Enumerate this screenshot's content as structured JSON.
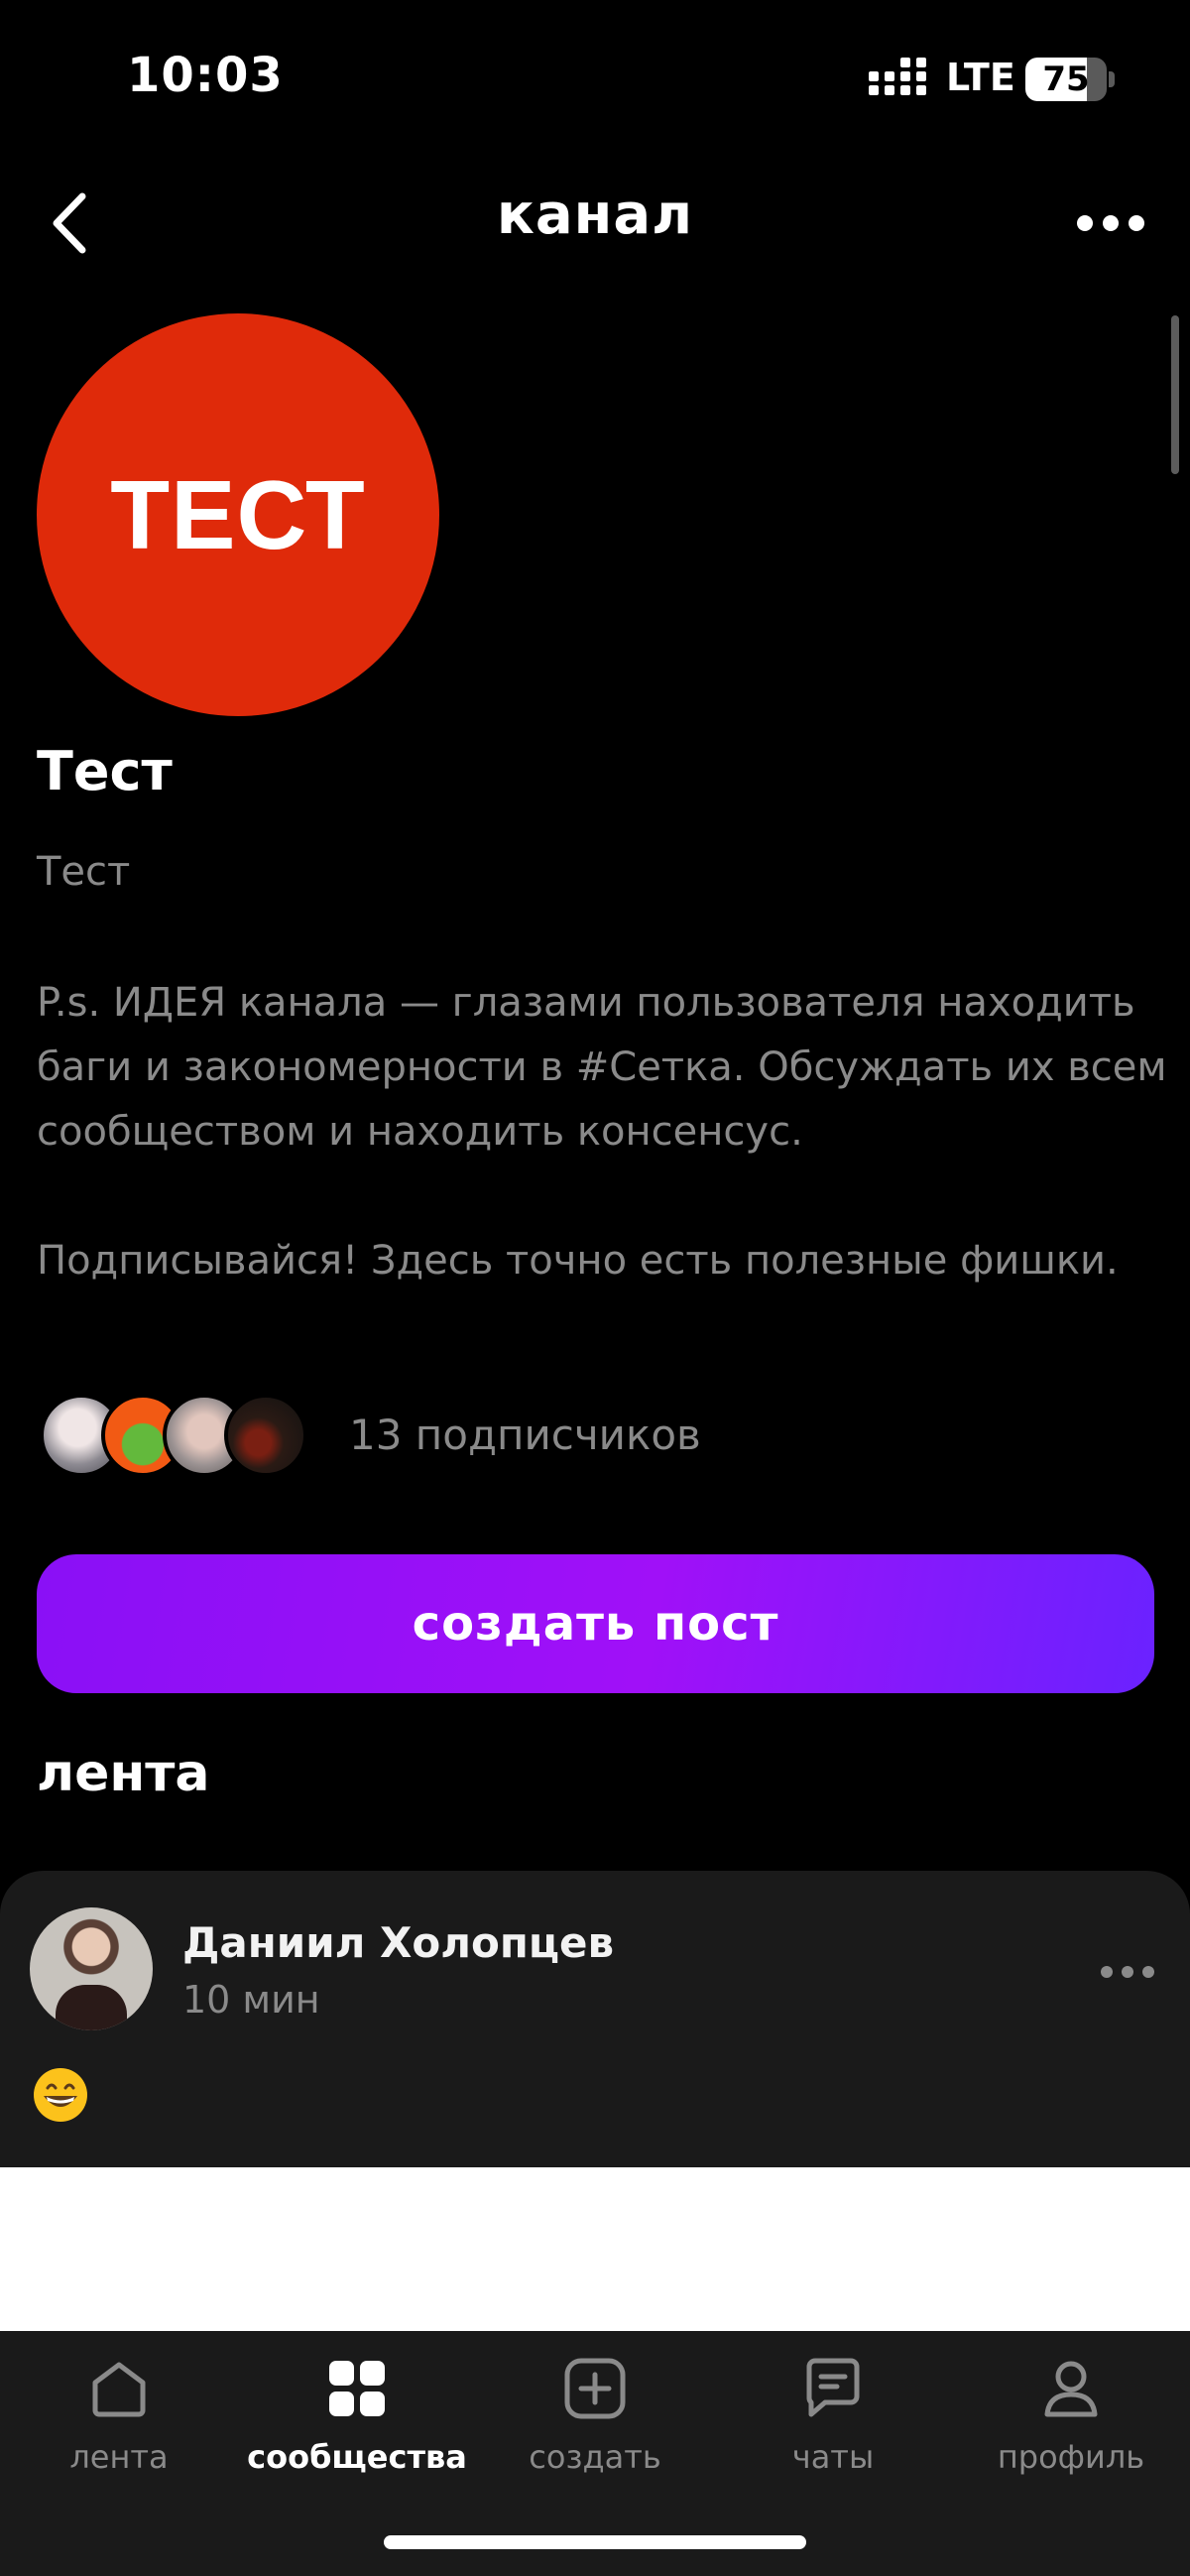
{
  "status_bar": {
    "time": "10:03",
    "network": "LTE",
    "battery": "75",
    "battery_level": 0.75
  },
  "header": {
    "title": "канал",
    "back_icon": "chevron-left-icon",
    "more_icon": "more-horizontal-icon"
  },
  "channel": {
    "avatar_text": "ТЕСТ",
    "avatar_color": "#df2a0a",
    "name": "Тест",
    "subtitle": "Тест",
    "description_1": "P.s. ИДЕЯ канала — глазами пользователя находить баги и закономерности в #Сетка. Обсуждать их всем сообществом и находить консенсус.",
    "description_2": "Подписывайся! Здесь точно есть полезные фишки.",
    "subscribers": "13 подписчиков"
  },
  "actions": {
    "create_post": "создать пост",
    "accent_start": "#8a10f6",
    "accent_end": "#6a22ff"
  },
  "feed": {
    "section_title": "лента",
    "post": {
      "author": "Даниил Холопцев",
      "time": "10 мин",
      "content_icon": "grinning-emoji-icon"
    }
  },
  "tab_bar": {
    "tabs": [
      {
        "label": "лента",
        "icon": "home-icon"
      },
      {
        "label": "сообщества",
        "icon": "grid-icon"
      },
      {
        "label": "создать",
        "icon": "plus-square-icon"
      },
      {
        "label": "чаты",
        "icon": "chat-icon"
      },
      {
        "label": "профиль",
        "icon": "person-icon"
      }
    ],
    "active": "сообщества"
  }
}
